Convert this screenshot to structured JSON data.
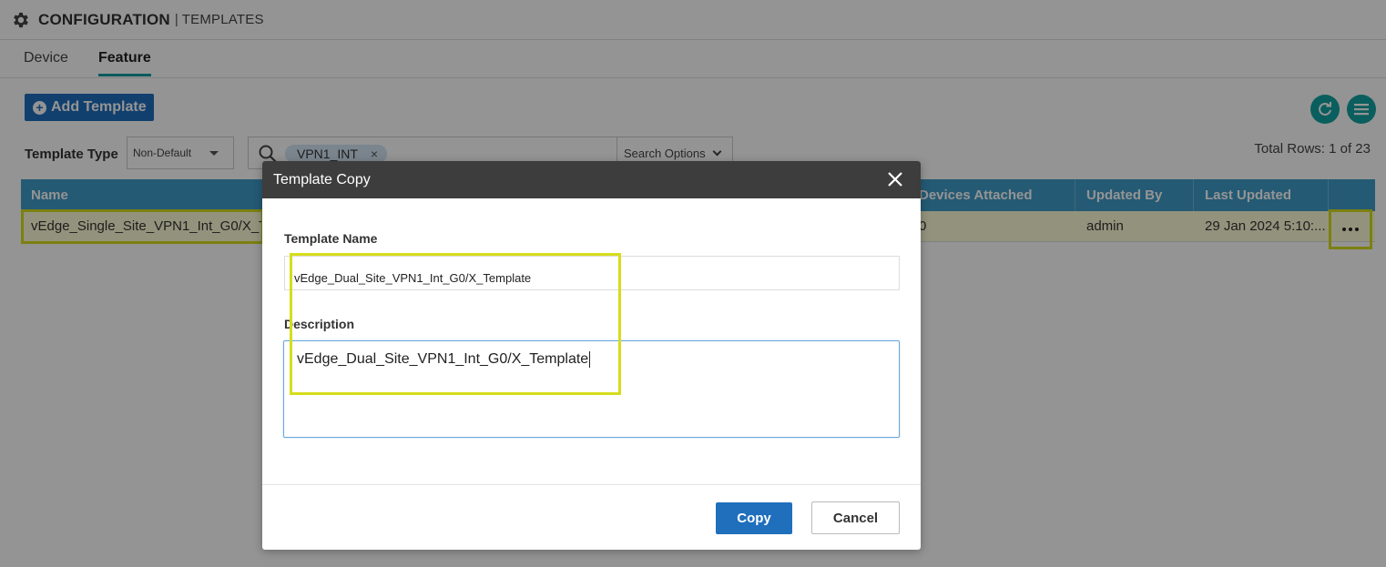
{
  "header": {
    "title": "CONFIGURATION",
    "separator": "|",
    "subtitle": "TEMPLATES"
  },
  "tabs": [
    {
      "label": "Device"
    },
    {
      "label": "Feature",
      "active": true
    }
  ],
  "toolbar": {
    "add_template_label": "Add Template"
  },
  "filters": {
    "template_type_label": "Template Type",
    "template_type_value": "Non-Default",
    "search_chip": "VPN1_INT",
    "search_options_label": "Search Options"
  },
  "total_rows": "Total Rows: 1 of 23",
  "table": {
    "columns": [
      "Name",
      "Devices Attached",
      "Updated By",
      "Last Updated"
    ],
    "rows": [
      {
        "name": "vEdge_Single_Site_VPN1_Int_G0/X_T",
        "devices_attached": "0",
        "updated_by": "admin",
        "last_updated": "29 Jan 2024 5:10:..."
      }
    ]
  },
  "modal": {
    "title": "Template Copy",
    "template_name_label": "Template Name",
    "template_name_value": "vEdge_Dual_Site_VPN1_Int_G0/X_Template",
    "description_label": "Description",
    "description_value": "vEdge_Dual_Site_VPN1_Int_G0/X_Template",
    "copy_label": "Copy",
    "cancel_label": "Cancel"
  },
  "colors": {
    "accent_blue": "#1f6fbd",
    "teal": "#14a3a3",
    "table_header": "#3e9cc8",
    "highlight": "#d6dc1c",
    "modal_header": "#3d3d3d"
  },
  "icons": [
    "gear-icon",
    "plus-icon",
    "refresh-icon",
    "menu-icon",
    "search-icon",
    "chip-close-icon",
    "chevron-down-icon",
    "more-icon",
    "close-icon"
  ]
}
